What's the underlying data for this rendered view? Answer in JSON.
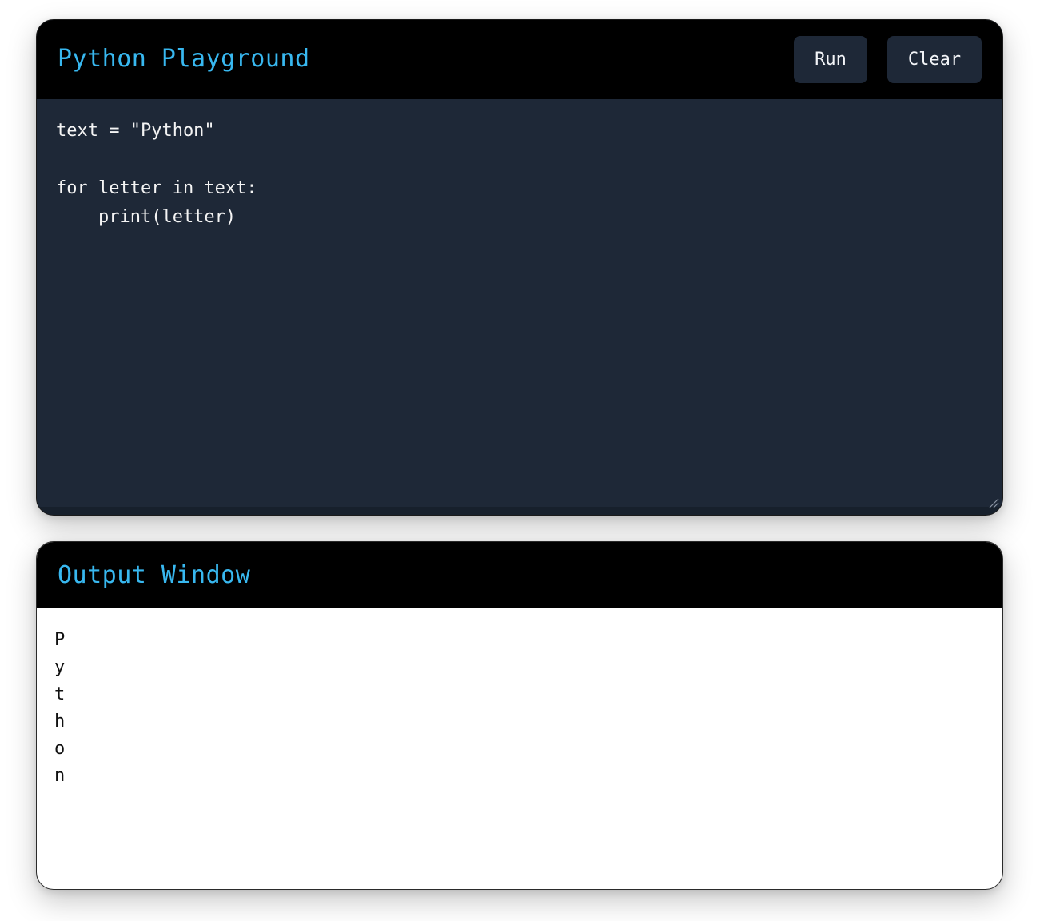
{
  "editor": {
    "title": "Python Playground",
    "run_label": "Run",
    "clear_label": "Clear",
    "code_lines": [
      "text = \"Python\"",
      "",
      "for letter in text:",
      "    print(letter)"
    ]
  },
  "output": {
    "title": "Output Window",
    "lines": [
      "P",
      "y",
      "t",
      "h",
      "o",
      "n"
    ]
  },
  "colors": {
    "accent": "#38b8f0",
    "header_bg": "#000000",
    "editor_bg": "#1e2837",
    "button_bg": "#1e2837",
    "output_bg": "#ffffff"
  },
  "icons": {
    "resize": "resize-handle-icon"
  }
}
